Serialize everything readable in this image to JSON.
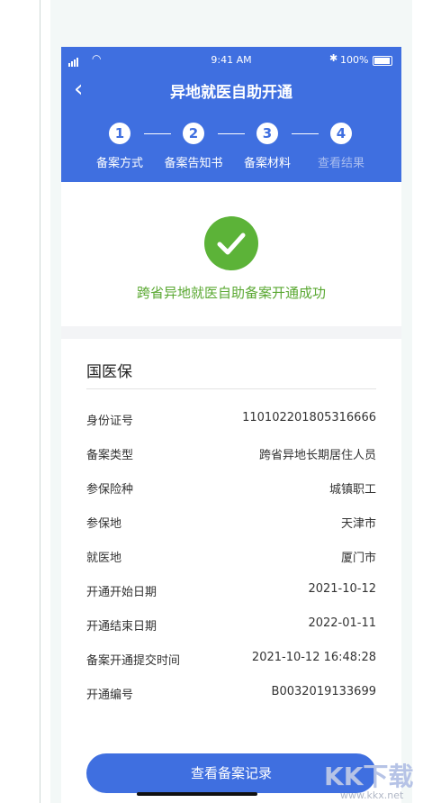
{
  "status_bar": {
    "time": "9:41 AM",
    "battery": "100%"
  },
  "nav": {
    "title": "异地就医自助开通"
  },
  "steps": [
    {
      "number": "1",
      "label": "备案方式"
    },
    {
      "number": "2",
      "label": "备案告知书"
    },
    {
      "number": "3",
      "label": "备案材料"
    },
    {
      "number": "4",
      "label": "查看结果"
    }
  ],
  "success": {
    "message": "跨省异地就医自助备案开通成功"
  },
  "info": {
    "title": "国医保",
    "rows": [
      {
        "key": "身份证号",
        "value": "110102201805316666"
      },
      {
        "key": "备案类型",
        "value": "跨省异地长期居住人员"
      },
      {
        "key": "参保险种",
        "value": "城镇职工"
      },
      {
        "key": "参保地",
        "value": "天津市"
      },
      {
        "key": "就医地",
        "value": "厦门市"
      },
      {
        "key": "开通开始日期",
        "value": "2021-10-12"
      },
      {
        "key": "开通结束日期",
        "value": "2022-01-11"
      },
      {
        "key": "备案开通提交时间",
        "value": "2021-10-12  16:48:28"
      },
      {
        "key": "开通编号",
        "value": "B0032019133699"
      }
    ]
  },
  "actions": {
    "view_records_label": "查看备案记录"
  },
  "watermark": {
    "logo": "KK下载",
    "url": "www.kkx.net"
  }
}
